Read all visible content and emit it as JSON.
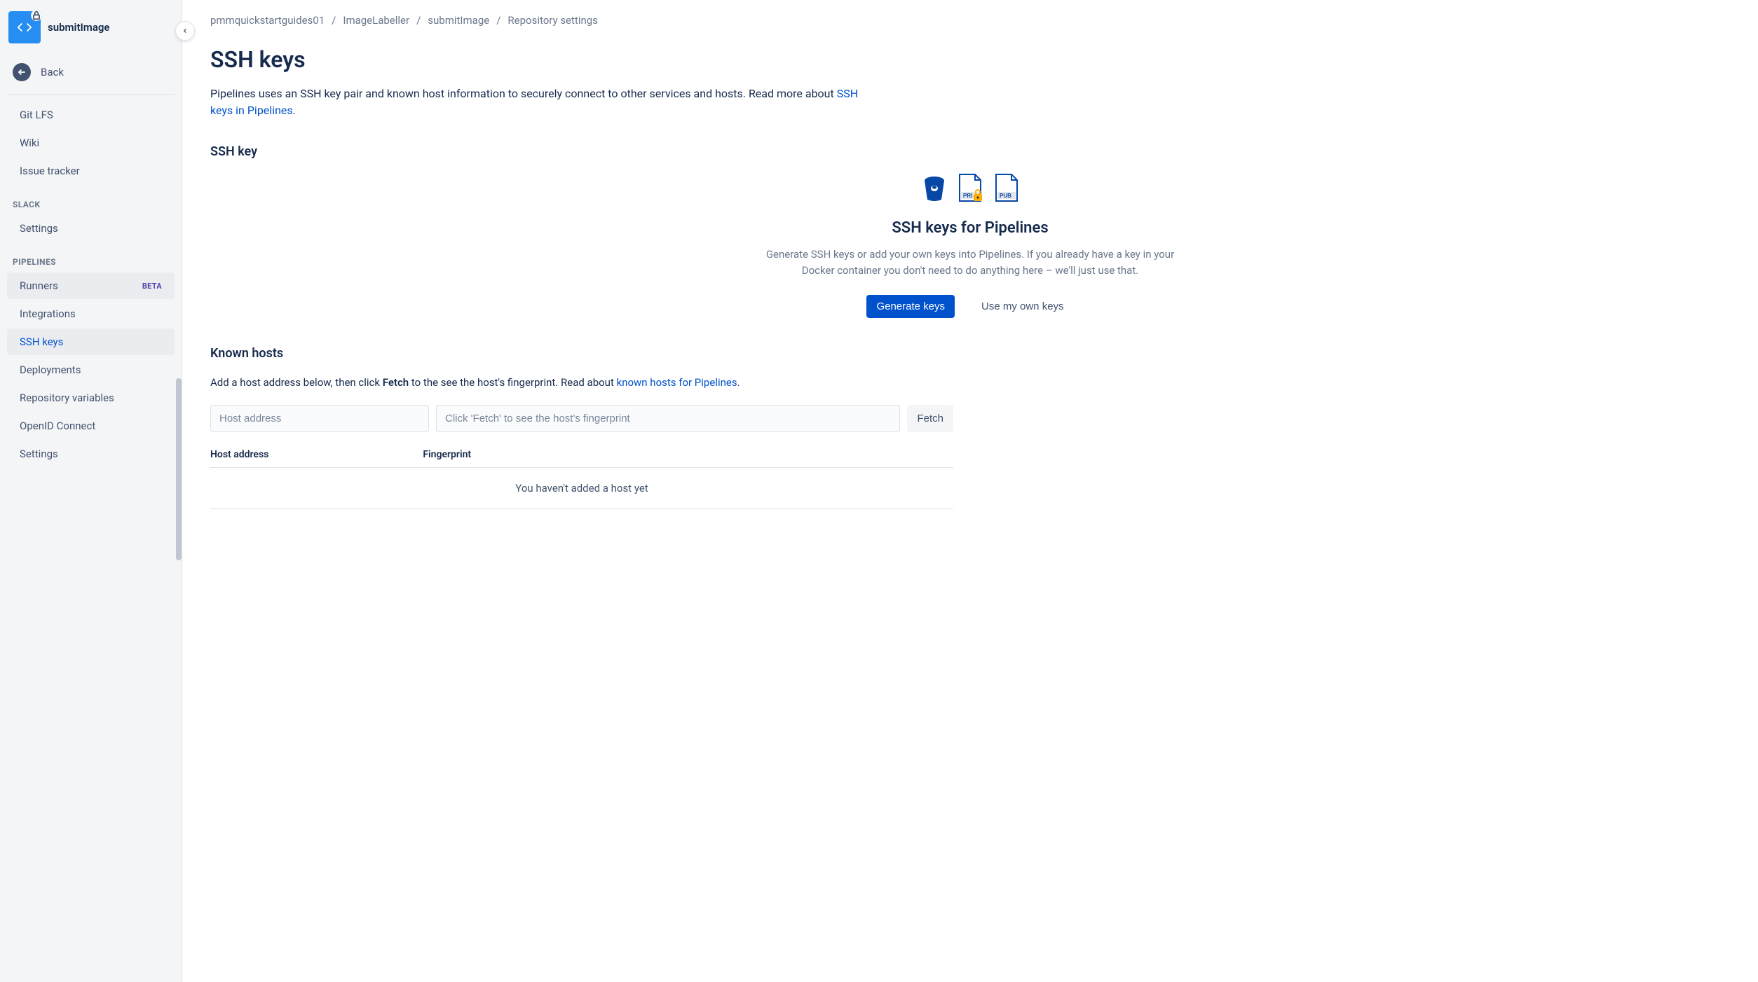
{
  "sidebar": {
    "repo_title": "submitImage",
    "back_label": "Back",
    "nav1": {
      "git_lfs": "Git LFS",
      "wiki": "Wiki",
      "issue_tracker": "Issue tracker"
    },
    "slack_label": "SLACK",
    "slack": {
      "settings": "Settings"
    },
    "pipelines_label": "PIPELINES",
    "pipelines": {
      "runners": "Runners",
      "runners_badge": "BETA",
      "integrations": "Integrations",
      "ssh_keys": "SSH keys",
      "deployments": "Deployments",
      "repo_vars": "Repository variables",
      "openid": "OpenID Connect",
      "settings": "Settings"
    }
  },
  "breadcrumbs": {
    "a": "pmmquickstartguides01",
    "b": "ImageLabeller",
    "c": "submitImage",
    "d": "Repository settings"
  },
  "page": {
    "title": "SSH keys",
    "intro_text": "Pipelines uses an SSH key pair and known host information to securely connect to other services and hosts. Read more about ",
    "intro_link": "SSH keys in Pipelines",
    "section_ssh": "SSH key",
    "panel_title": "SSH keys for Pipelines",
    "panel_desc": "Generate SSH keys or add your own keys into Pipelines. If you already have a key in your Docker container you don't need to do anything here – we'll just use that.",
    "generate_btn": "Generate keys",
    "own_keys_btn": "Use my own keys",
    "known_hosts_title": "Known hosts",
    "kh_desc1": "Add a host address below, then click ",
    "kh_fetch_bold": "Fetch",
    "kh_desc2": " to the see the host's fingerprint. Read about ",
    "kh_link": "known hosts for Pipelines",
    "host_placeholder": "Host address",
    "fp_placeholder": "Click 'Fetch' to see the host's fingerprint",
    "fetch_btn": "Fetch",
    "col_host": "Host address",
    "col_fp": "Fingerprint",
    "empty": "You haven't added a host yet"
  }
}
